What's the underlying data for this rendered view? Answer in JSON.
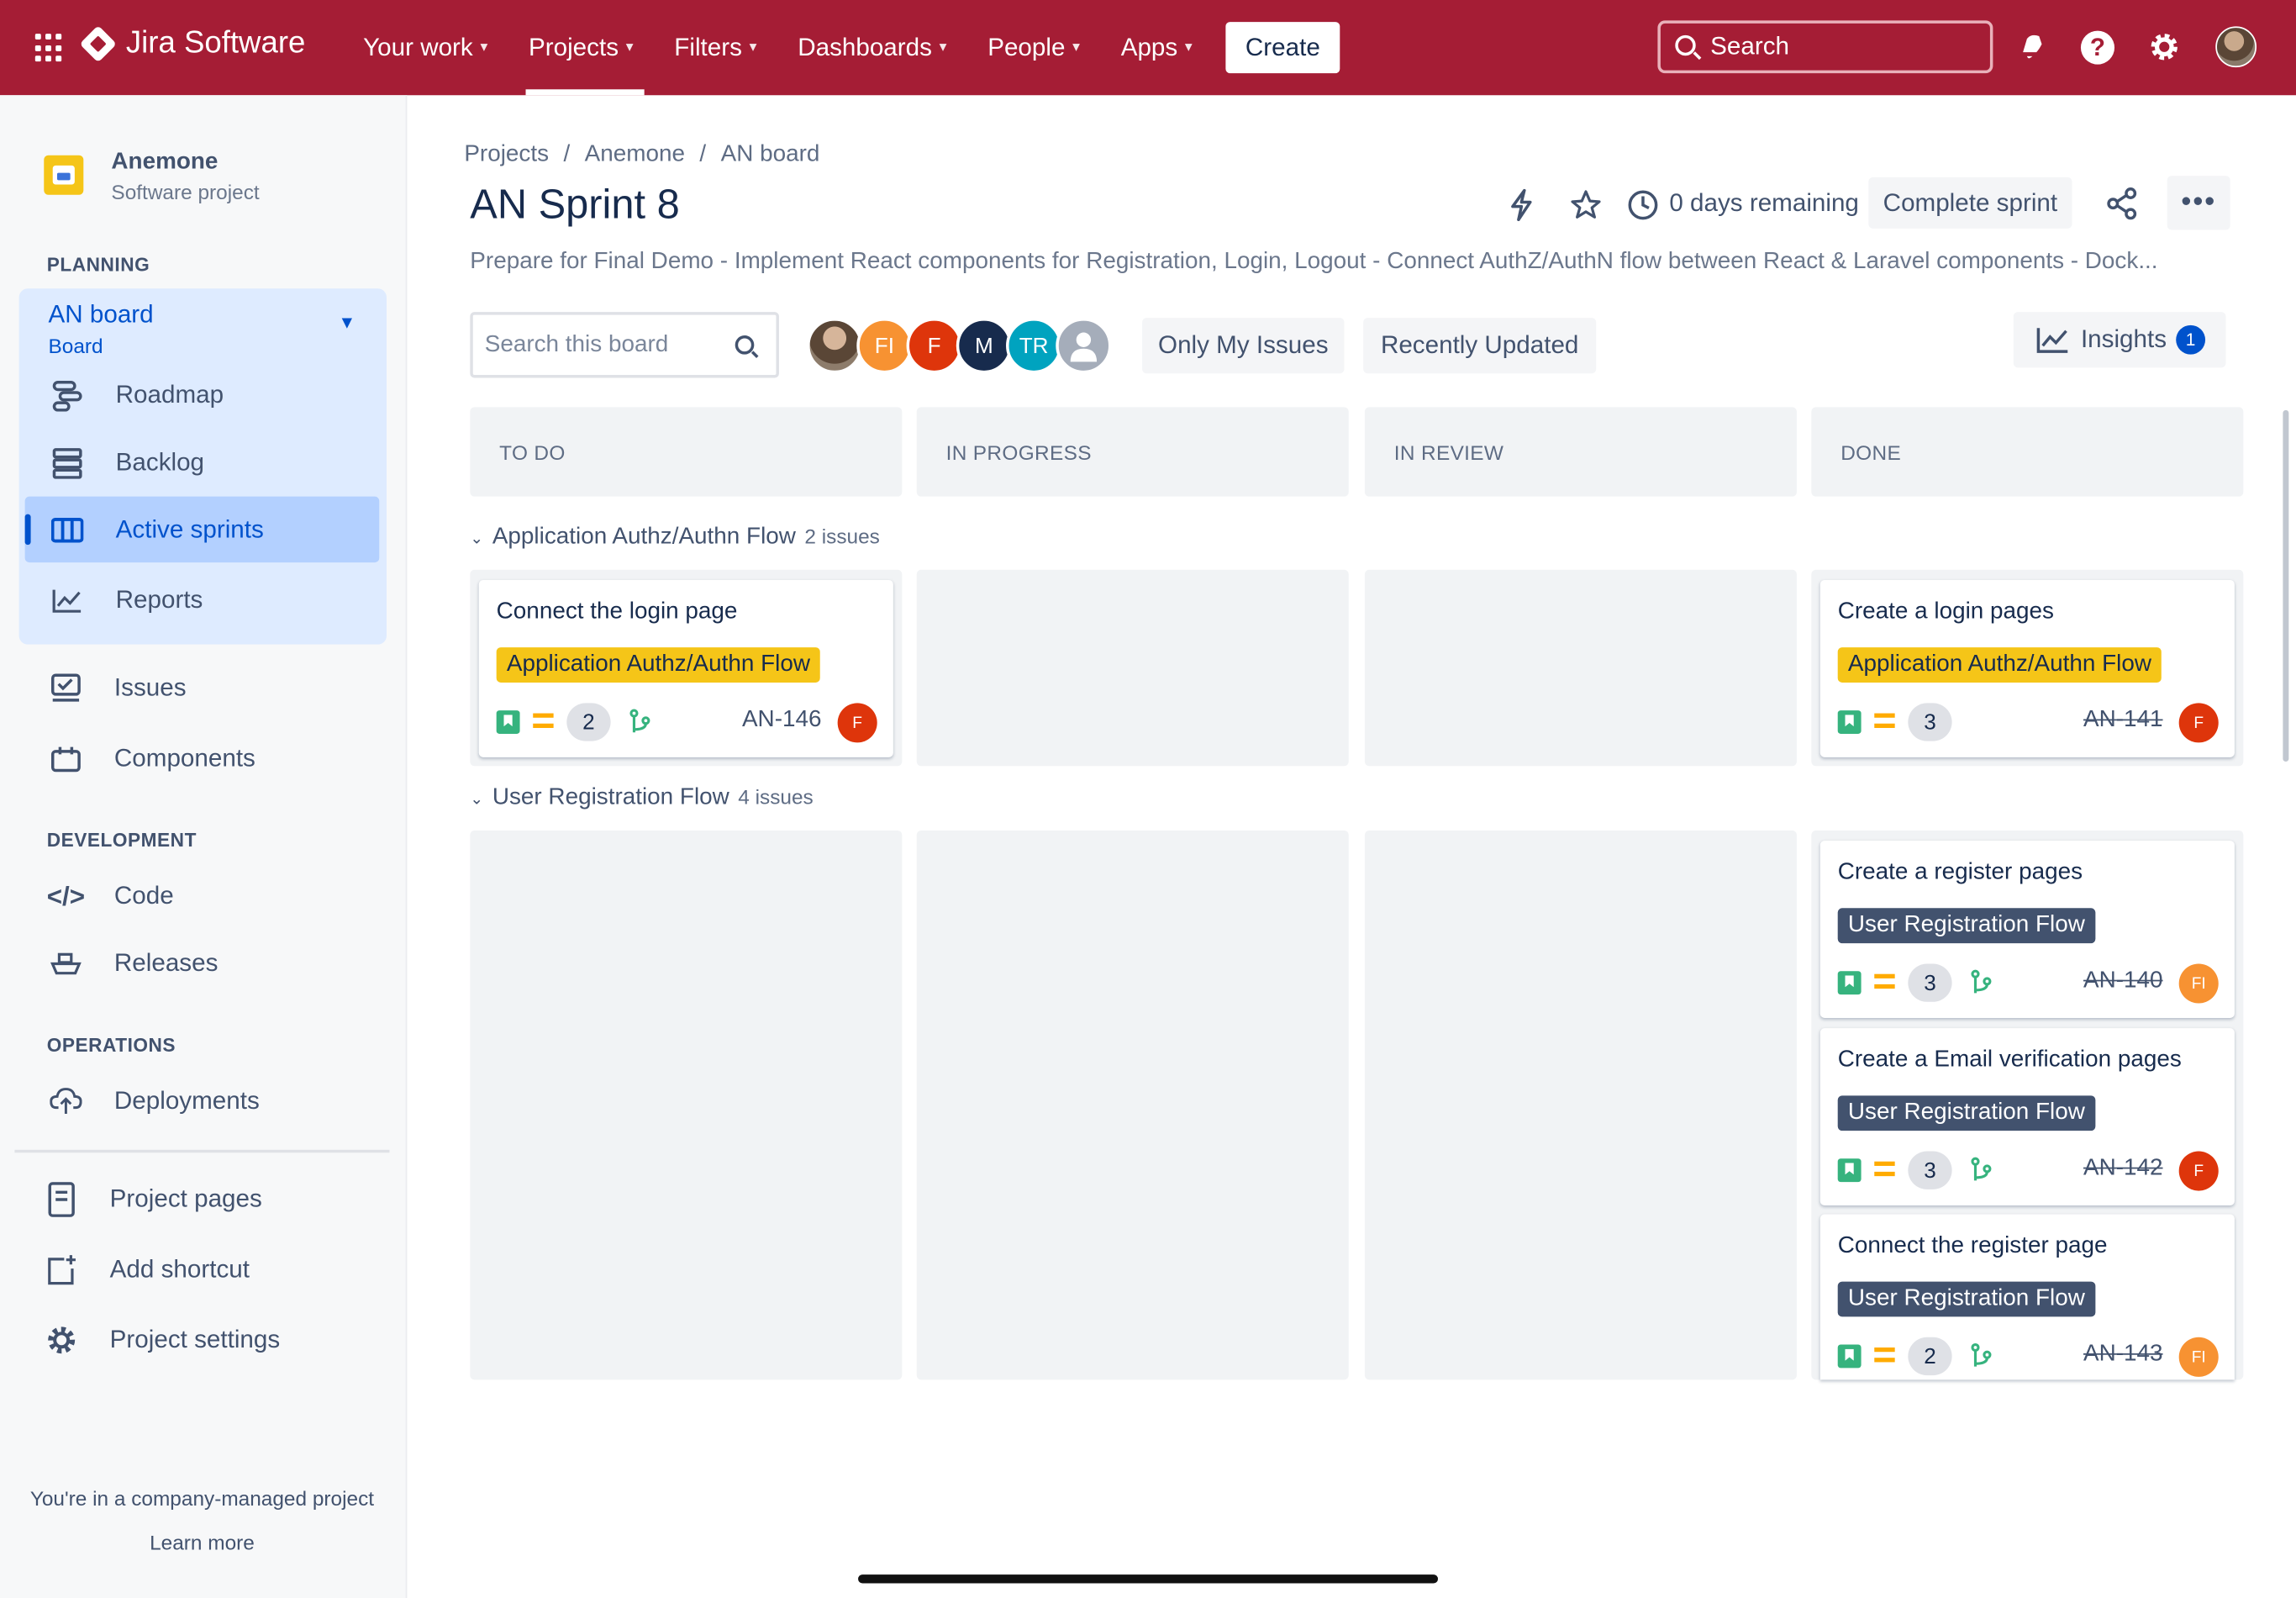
{
  "nav": {
    "logo": "Jira Software",
    "items": [
      "Your work",
      "Projects",
      "Filters",
      "Dashboards",
      "People",
      "Apps"
    ],
    "create": "Create",
    "search_placeholder": "Search"
  },
  "sidebar": {
    "project_name": "Anemone",
    "project_type": "Software project",
    "planning_label": "PLANNING",
    "board_title": "AN board",
    "board_sub": "Board",
    "planning_items": [
      "Roadmap",
      "Backlog",
      "Active sprints",
      "Reports"
    ],
    "other_items": [
      "Issues",
      "Components"
    ],
    "development_label": "DEVELOPMENT",
    "development_items": [
      "Code",
      "Releases"
    ],
    "operations_label": "OPERATIONS",
    "operations_items": [
      "Deployments"
    ],
    "bottom_items": [
      "Project pages",
      "Add shortcut",
      "Project settings"
    ],
    "company_note": "You're in a company-managed project",
    "learn_more": "Learn more"
  },
  "breadcrumb": [
    "Projects",
    "Anemone",
    "AN board"
  ],
  "title": "AN Sprint 8",
  "days_remaining": "0 days remaining",
  "complete_sprint": "Complete sprint",
  "more": "•••",
  "sprint_goal": "Prepare for Final Demo - Implement React components for Registration, Login, Logout - Connect AuthZ/AuthN flow between React & Laravel components - Dock...",
  "board_search_placeholder": "Search this board",
  "avatars": [
    {
      "label": "",
      "color": "#6b5a4a"
    },
    {
      "label": "FI",
      "color": "#f79232"
    },
    {
      "label": "F",
      "color": "#de350b"
    },
    {
      "label": "M",
      "color": "#172b4d"
    },
    {
      "label": "TR",
      "color": "#00a3bf"
    },
    {
      "label": "",
      "color": "#a5adba"
    }
  ],
  "filters": {
    "only_my_issues": "Only My Issues",
    "recently_updated": "Recently Updated",
    "insights": "Insights",
    "insights_count": "1"
  },
  "columns": [
    "TO DO",
    "IN PROGRESS",
    "IN REVIEW",
    "DONE"
  ],
  "swimlanes": [
    {
      "name": "Application Authz/Authn Flow",
      "count": "2 issues"
    },
    {
      "name": "User Registration Flow",
      "count": "4 issues"
    }
  ],
  "cards": [
    {
      "title": "Connect the login page",
      "epic": "Application Authz/Authn Flow",
      "points": "2",
      "key": "AN-146",
      "avatar": "F",
      "avatar_color": "#de350b"
    },
    {
      "title": "Create a login pages",
      "epic": "Application Authz/Authn Flow",
      "points": "3",
      "key": "AN-141",
      "avatar": "F",
      "avatar_color": "#de350b"
    },
    {
      "title": "Create a register pages",
      "epic": "User Registration Flow",
      "points": "3",
      "key": "AN-140",
      "avatar": "FI",
      "avatar_color": "#f79232"
    },
    {
      "title": "Create a Email verification pages",
      "epic": "User Registration Flow",
      "points": "3",
      "key": "AN-142",
      "avatar": "F",
      "avatar_color": "#de350b"
    },
    {
      "title": "Connect the register page",
      "epic": "User Registration Flow",
      "points": "2",
      "key": "AN-143",
      "avatar": "FI",
      "avatar_color": "#f79232"
    }
  ]
}
